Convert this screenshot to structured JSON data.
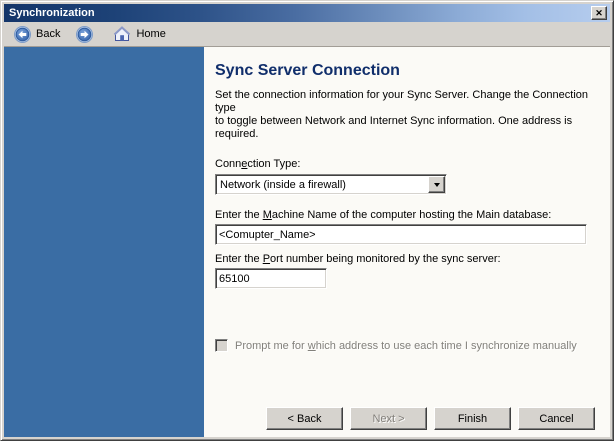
{
  "window": {
    "title": "Synchronization"
  },
  "icons": {
    "close": "✕",
    "back": "blue-circle-left-arrow",
    "forward": "blue-circle-right-arrow",
    "home": "house",
    "dropdown": "down-triangle"
  },
  "toolbar": {
    "back_label": "Back",
    "home_label": "Home"
  },
  "main": {
    "heading": "Sync Server Connection",
    "description_lines": [
      "Set the connection information for your Sync Server. Change the Connection type",
      "to toggle between Network and Internet Sync information. One address is",
      "required."
    ],
    "connection_type": {
      "label_pre": "Conn",
      "label_key": "e",
      "label_post": "ction Type:",
      "value": "Network (inside a firewall)"
    },
    "machine": {
      "label_pre": "Enter the ",
      "label_key": "M",
      "label_post": "achine Name of the computer hosting the Main database:",
      "value": "<Comupter_Name>"
    },
    "port": {
      "label_pre": "Enter the ",
      "label_key": "P",
      "label_post": "ort number being monitored by the sync server:",
      "value": "65100"
    },
    "prompt_checkbox": {
      "label_pre": "Prompt me for ",
      "label_key": "w",
      "label_post": "hich address to use each time I synchronize manually",
      "checked": "false",
      "enabled": "false"
    }
  },
  "footer": {
    "back_label": "< Back",
    "next_label": "Next >",
    "finish_label": "Finish",
    "cancel_label": "Cancel"
  },
  "colors": {
    "titlebar_gradient_start": "#143569",
    "titlebar_gradient_end": "#b6cdee",
    "sidebar_blue": "#3a6da4",
    "chrome_gray": "#d6d3ce",
    "content_bg": "#fbfaf6",
    "heading_navy": "#102e6b",
    "disabled_text": "#827f7a"
  }
}
